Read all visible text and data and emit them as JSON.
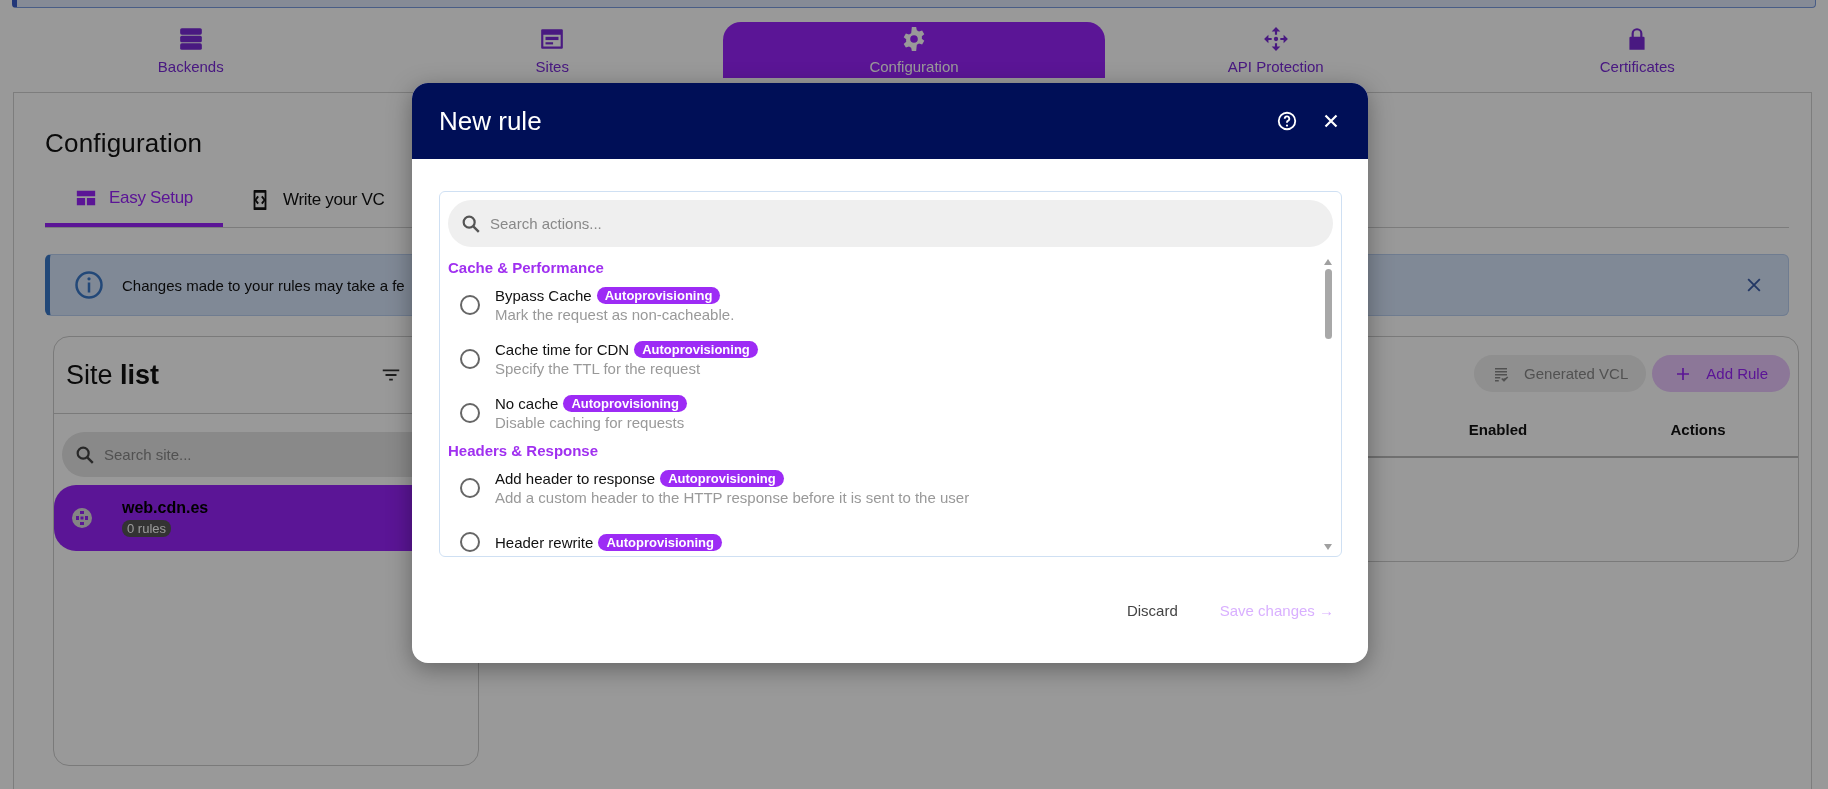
{
  "nav": [
    {
      "label": "Backends",
      "selected": false
    },
    {
      "label": "Sites",
      "selected": false
    },
    {
      "label": "Configuration",
      "selected": true
    },
    {
      "label": "API Protection",
      "selected": false
    },
    {
      "label": "Certificates",
      "selected": false
    }
  ],
  "heading": "Configuration",
  "tabs": [
    {
      "label": "Easy Setup",
      "selected": true
    },
    {
      "label": "Write your VC",
      "selected": false
    }
  ],
  "banner": {
    "text": "Changes made to your rules may take a fe"
  },
  "site_list": {
    "title": "Site **list**",
    "search": {
      "placeholder": "Search site..."
    },
    "sites": [
      {
        "name": "web.cdn.es",
        "count": "0 rules",
        "selected": true
      }
    ]
  },
  "rules": {
    "buttons": [
      {
        "label": "Generated VCL",
        "kind": "secondary"
      },
      {
        "label": "Add Rule",
        "kind": "primary"
      }
    ],
    "columns": [
      "Enabled",
      "Actions"
    ]
  },
  "modal": {
    "title": "New rule",
    "search": {
      "placeholder": "Search actions..."
    },
    "groups": [
      {
        "title": "Cache & Performance",
        "actions": [
          {
            "name": "Bypass Cache",
            "badge": "Autoprovisioning",
            "description": "Mark the request as non-cacheable.",
            "selected": false
          },
          {
            "name": "Cache time for CDN",
            "badge": "Autoprovisioning",
            "description": "Specify the TTL for the request",
            "selected": false
          },
          {
            "name": "No cache",
            "badge": "Autoprovisioning",
            "description": "Disable caching for requests",
            "selected": false
          }
        ]
      },
      {
        "title": "Headers & Response",
        "actions": [
          {
            "name": "Add header to response",
            "badge": "Autoprovisioning",
            "description": "Add a custom header to the HTTP response before it is sent to the user",
            "selected": false
          },
          {
            "name": "Header rewrite",
            "badge": "Autoprovisioning",
            "selected": false
          }
        ]
      }
    ],
    "buttons": [
      {
        "label": "Discard",
        "disabled": false
      },
      {
        "label": "Save changes →",
        "disabled": true
      }
    ]
  }
}
